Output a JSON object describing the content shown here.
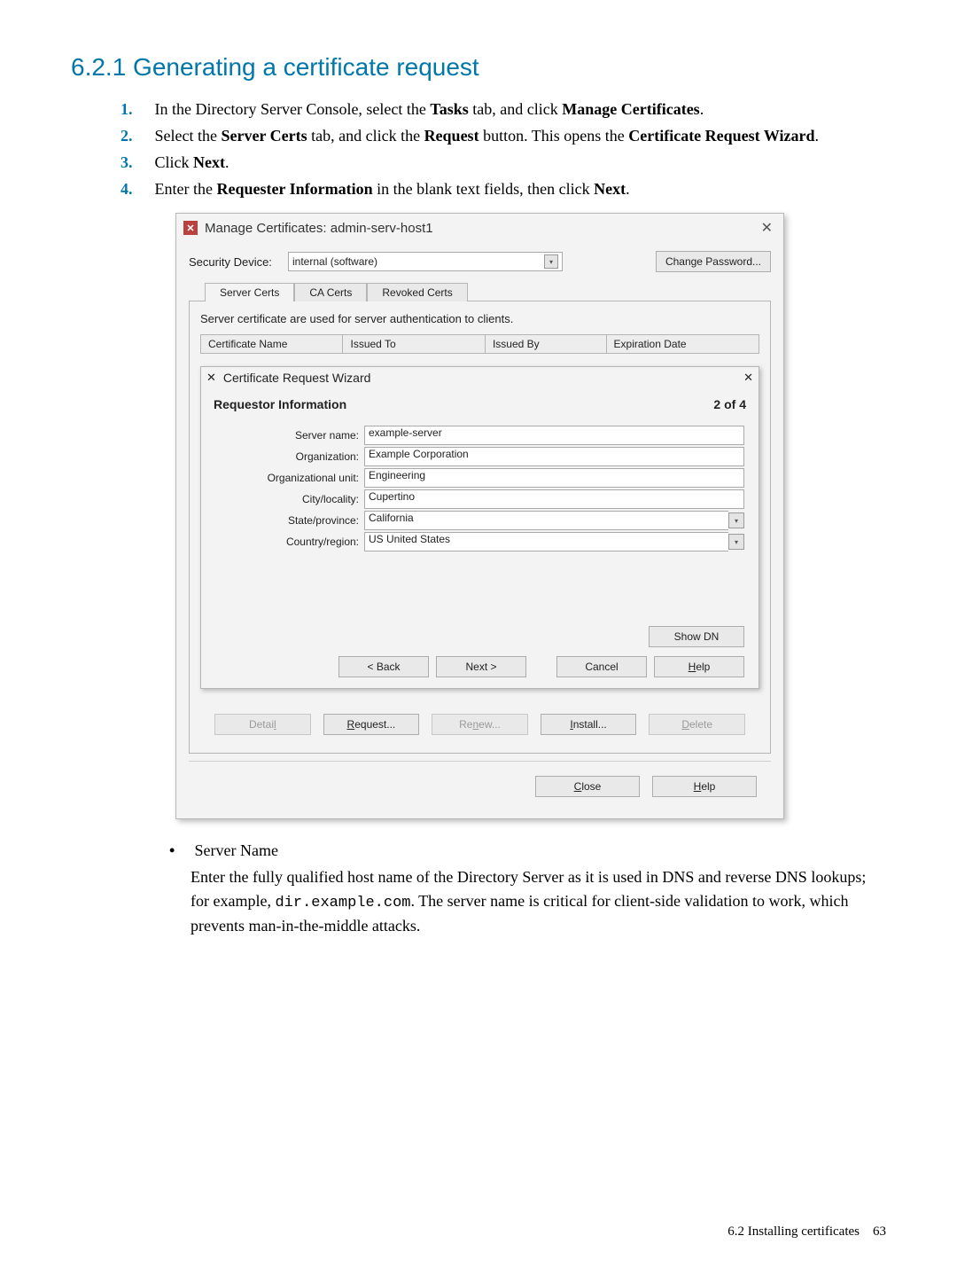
{
  "heading": "6.2.1 Generating a certificate request",
  "steps": {
    "s1a": "In the Directory Server Console, select the ",
    "s1b": "Tasks",
    "s1c": " tab, and click ",
    "s1d": "Manage Certificates",
    "s1e": ".",
    "s2a": "Select the ",
    "s2b": "Server Certs",
    "s2c": " tab, and click the ",
    "s2d": "Request",
    "s2e": " button. This opens the ",
    "s2f": "Certificate Request Wizard",
    "s2g": ".",
    "s3a": "Click ",
    "s3b": "Next",
    "s3c": ".",
    "s4a": "Enter the ",
    "s4b": "Requester Information",
    "s4c": " in the blank text fields, then click ",
    "s4d": "Next",
    "s4e": "."
  },
  "outer": {
    "title": "Manage Certificates: admin-serv-host1",
    "secDevLabel": "Security Device:",
    "secDevValue": "internal (software)",
    "changePwd": "Change Password...",
    "tabs": [
      "Server Certs",
      "CA Certs",
      "Revoked Certs"
    ],
    "desc": "Server certificate are used for server authentication to clients.",
    "cols": [
      "Certificate Name",
      "Issued To",
      "Issued By",
      "Expiration Date"
    ],
    "detail": "Detai",
    "request": "equest...",
    "renew": "Re",
    "renew2": "ew...",
    "install": "nstall...",
    "delete": "elete",
    "close": "lose",
    "help": "elp",
    "detail_l": "l",
    "request_R": "R",
    "renew_n": "n",
    "install_I": "I",
    "delete_D": "D",
    "close_C": "C",
    "help_H": "H"
  },
  "wiz": {
    "title": "Certificate Request Wizard",
    "stepTitle": "Requestor Information",
    "stepCount": "2 of 4",
    "labels": {
      "server": "Server name:",
      "org": "Organization:",
      "ou": "Organizational unit:",
      "city": "City/locality:",
      "state": "State/province:",
      "country": "Country/region:"
    },
    "vals": {
      "server": "example-server",
      "org": "Example Corporation",
      "ou": "Engineering",
      "city": "Cupertino",
      "state": "California",
      "country": "US United States"
    },
    "showdn": "Show DN",
    "back": "< Back",
    "next": "Next >",
    "cancel": "Cancel",
    "help": "elp",
    "help_H": "H"
  },
  "bullet": {
    "title": "Server Name",
    "p1a": "Enter the fully qualified host name of the Directory Server as it is used in DNS and reverse DNS lookups; for example, ",
    "p1code": "dir.example.com",
    "p1b": ". The server name is critical for client-side validation to work, which prevents man-in-the-middle attacks."
  },
  "footer": {
    "text": "6.2 Installing certificates",
    "page": "63"
  }
}
